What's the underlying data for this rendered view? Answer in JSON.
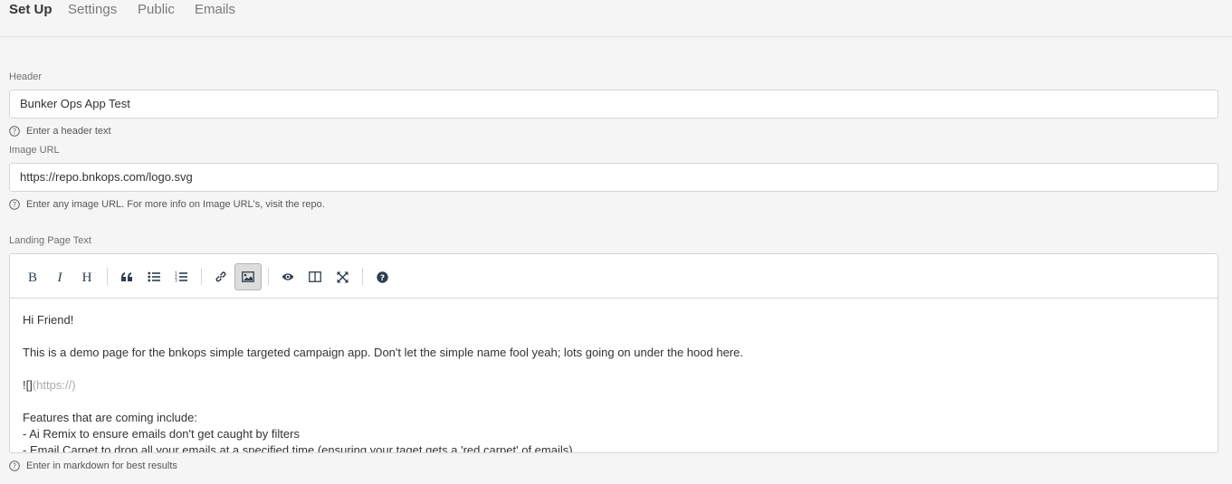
{
  "tabs": [
    {
      "label": "Set Up",
      "active": true
    },
    {
      "label": "Settings",
      "active": false
    },
    {
      "label": "Public",
      "active": false
    },
    {
      "label": "Emails",
      "active": false
    }
  ],
  "header_field": {
    "label": "Header",
    "value": "Bunker Ops App Test",
    "help": "Enter a header text"
  },
  "image_field": {
    "label": "Image URL",
    "value": "https://repo.bnkops.com/logo.svg",
    "help": "Enter any image URL. For more info on Image URL's, visit the repo."
  },
  "landing_field": {
    "label": "Landing Page Text",
    "help": "Enter in markdown for best results",
    "toolbar": [
      {
        "name": "bold-button",
        "icon": "bold-icon",
        "active": false
      },
      {
        "name": "italic-button",
        "icon": "italic-icon",
        "active": false
      },
      {
        "name": "heading-button",
        "icon": "heading-icon",
        "active": false
      },
      {
        "name": "quote-button",
        "icon": "quote-icon",
        "active": false
      },
      {
        "name": "unordered-list-button",
        "icon": "unordered-list-icon",
        "active": false
      },
      {
        "name": "ordered-list-button",
        "icon": "ordered-list-icon",
        "active": false
      },
      {
        "name": "link-button",
        "icon": "link-icon",
        "active": false
      },
      {
        "name": "image-button",
        "icon": "image-icon",
        "active": true
      },
      {
        "name": "preview-button",
        "icon": "eye-icon",
        "active": false
      },
      {
        "name": "side-by-side-button",
        "icon": "columns-icon",
        "active": false
      },
      {
        "name": "fullscreen-button",
        "icon": "fullscreen-icon",
        "active": false
      },
      {
        "name": "guide-button",
        "icon": "help-circle-icon",
        "active": false
      }
    ],
    "content": {
      "line1": "Hi Friend!",
      "line2": "This is a demo page for the bnkops simple targeted campaign app. Don't let the simple name fool yeah; lots going on under the hood here.",
      "line3_prefix": "![]",
      "line3_url": "(https://)",
      "line4": "Features that are coming include:",
      "line5": "- Ai Remix to ensure emails don't get caught by filters",
      "line6": "- Email Carpet to drop all your emails at a specified time (ensuring your taget gets a 'red carpet' of emails)"
    }
  }
}
